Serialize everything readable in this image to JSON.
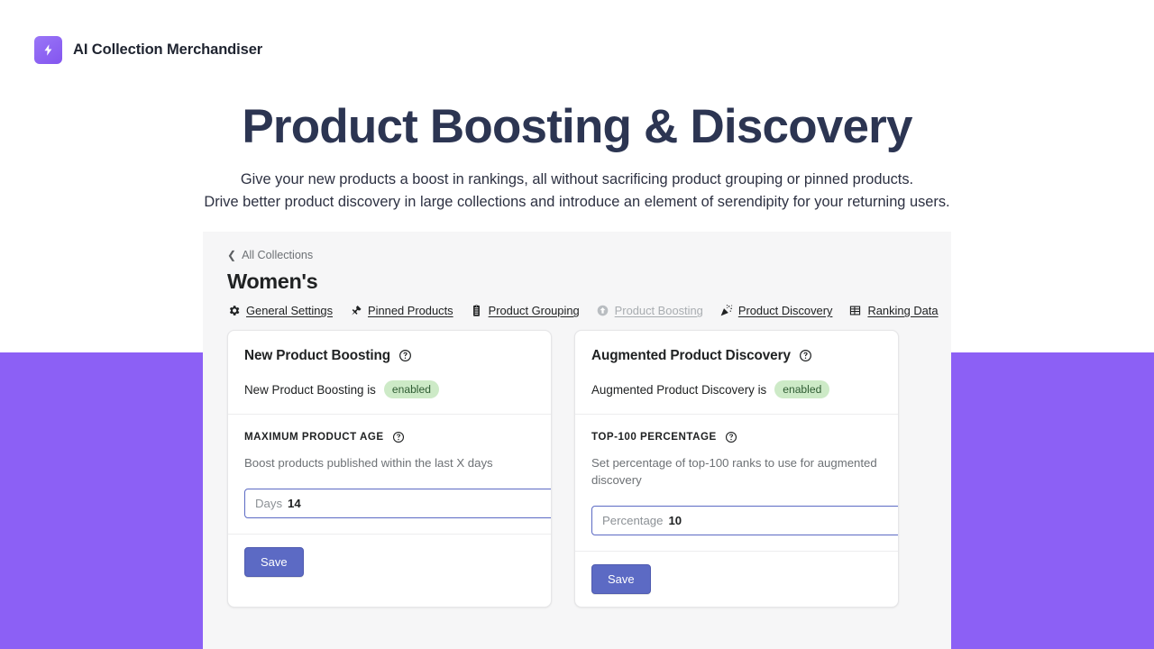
{
  "brand": {
    "name": "AI Collection Merchandiser",
    "logo_icon": "lightning-bolt-icon",
    "logo_color": "#8355ef"
  },
  "hero": {
    "title": "Product Boosting & Discovery",
    "subtitle_line1": "Give your new products a boost in rankings, all without sacrificing product grouping or pinned products.",
    "subtitle_line2": "Drive better product discovery in large collections and introduce an element of serendipity for your returning users."
  },
  "app": {
    "breadcrumb": {
      "icon": "chevron-left-icon",
      "label": "All Collections"
    },
    "collection_title": "Women's",
    "tabs": [
      {
        "label": "General Settings",
        "icon": "gear-icon",
        "active": false
      },
      {
        "label": "Pinned Products",
        "icon": "pushpin-icon",
        "active": false
      },
      {
        "label": "Product Grouping",
        "icon": "clipboard-icon",
        "active": false
      },
      {
        "label": "Product Boosting",
        "icon": "arrow-up-circle-icon",
        "active": true
      },
      {
        "label": "Product Discovery",
        "icon": "party-popper-icon",
        "active": false
      },
      {
        "label": "Ranking Data",
        "icon": "table-icon",
        "active": false
      }
    ],
    "cards": [
      {
        "title": "New Product Boosting",
        "help_icon": "question-circle-icon",
        "status_text": "New Product Boosting is",
        "status_badge": "enabled",
        "field_label": "MAXIMUM PRODUCT AGE",
        "field_help": "Boost products published within the last X days",
        "input_placeholder": "Days",
        "input_value": "14",
        "save_label": "Save"
      },
      {
        "title": "Augmented Product Discovery",
        "help_icon": "question-circle-icon",
        "status_text": "Augmented Product Discovery is",
        "status_badge": "enabled",
        "field_label": "TOP-100 PERCENTAGE",
        "field_help": "Set percentage of top-100 ranks to use for augmented discovery",
        "input_placeholder": "Percentage",
        "input_value": "10",
        "save_label": "Save"
      }
    ]
  },
  "colors": {
    "accent_purple": "#8c60f5",
    "button_indigo": "#5c6ac4",
    "badge_green_bg": "#cdeac7",
    "badge_green_text": "#2f5c33",
    "title_navy": "#2c3552"
  }
}
